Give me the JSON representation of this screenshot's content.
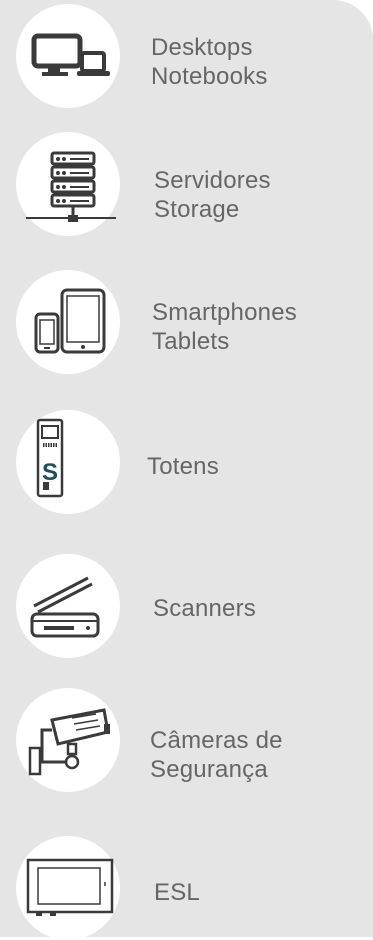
{
  "colors": {
    "panel_background": "#e5e5e5",
    "circle_background": "#ffffff",
    "label_text": "#666666",
    "icon_stroke": "#3a3a3a",
    "icon_accent": "#1e4d5c"
  },
  "items": [
    {
      "icon": "desktop-notebook-icon",
      "lines": [
        "Desktops",
        "Notebooks"
      ]
    },
    {
      "icon": "server-rack-icon",
      "lines": [
        "Servidores",
        "Storage"
      ]
    },
    {
      "icon": "smartphone-tablet-icon",
      "lines": [
        "Smartphones",
        "Tablets"
      ]
    },
    {
      "icon": "kiosk-totem-icon",
      "lines": [
        "Totens"
      ]
    },
    {
      "icon": "flatbed-scanner-icon",
      "lines": [
        "Scanners"
      ]
    },
    {
      "icon": "security-camera-icon",
      "lines": [
        "Câmeras de",
        "Segurança"
      ]
    },
    {
      "icon": "esl-price-tag-icon",
      "lines": [
        "ESL"
      ]
    }
  ]
}
